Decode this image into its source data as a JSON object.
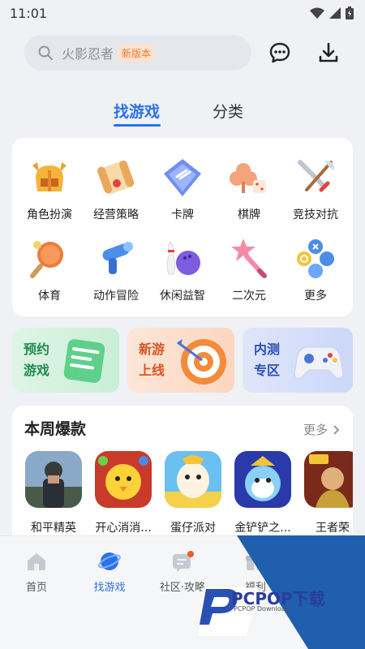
{
  "status_bar": {
    "time": "11:01"
  },
  "search": {
    "placeholder": "火影忍者",
    "badge": "新版本"
  },
  "header_icons": [
    "message-icon",
    "download-icon"
  ],
  "tabs": [
    {
      "label": "找游戏",
      "active": true
    },
    {
      "label": "分类",
      "active": false
    }
  ],
  "categories": [
    {
      "label": "角色扮演",
      "icon": "helmet-icon"
    },
    {
      "label": "经营策略",
      "icon": "scroll-icon"
    },
    {
      "label": "卡牌",
      "icon": "card-icon"
    },
    {
      "label": "棋牌",
      "icon": "clover-dice-icon"
    },
    {
      "label": "竞技对抗",
      "icon": "sword-axe-icon"
    },
    {
      "label": "体育",
      "icon": "pingpong-icon"
    },
    {
      "label": "动作冒险",
      "icon": "blaster-icon"
    },
    {
      "label": "休闲益智",
      "icon": "bowling-icon"
    },
    {
      "label": "二次元",
      "icon": "star-wand-icon"
    },
    {
      "label": "更多",
      "icon": "gamepad-buttons-icon"
    }
  ],
  "banners": [
    {
      "label": "预约游戏",
      "line1": "预约",
      "line2": "游戏",
      "icon": "calendar-icon",
      "color": "#1e8b4c"
    },
    {
      "label": "新游上线",
      "line1": "新游",
      "line2": "上线",
      "icon": "target-icon",
      "color": "#d9531e"
    },
    {
      "label": "内测专区",
      "line1": "内测",
      "line2": "专区",
      "icon": "gamepad-icon",
      "color": "#2a4fb5"
    }
  ],
  "weekly": {
    "title": "本周爆款",
    "more": "更多",
    "games": [
      {
        "name": "和平精英"
      },
      {
        "name": "开心消消..."
      },
      {
        "name": "蛋仔派对"
      },
      {
        "name": "金铲铲之..."
      },
      {
        "name": "王者荣"
      }
    ]
  },
  "nav": [
    {
      "label": "首页",
      "icon": "home-icon",
      "active": false
    },
    {
      "label": "找游戏",
      "icon": "planet-icon",
      "active": true
    },
    {
      "label": "社区·攻略",
      "icon": "chat-icon",
      "active": false
    },
    {
      "label": "福利",
      "icon": "gift-icon",
      "active": false
    }
  ],
  "watermark": {
    "text": "PCPOP下载",
    "sub": "PCPOP Download"
  },
  "colors": {
    "accent": "#2a72e8",
    "badge": "#f07a2e",
    "background": "#eff1f4"
  }
}
